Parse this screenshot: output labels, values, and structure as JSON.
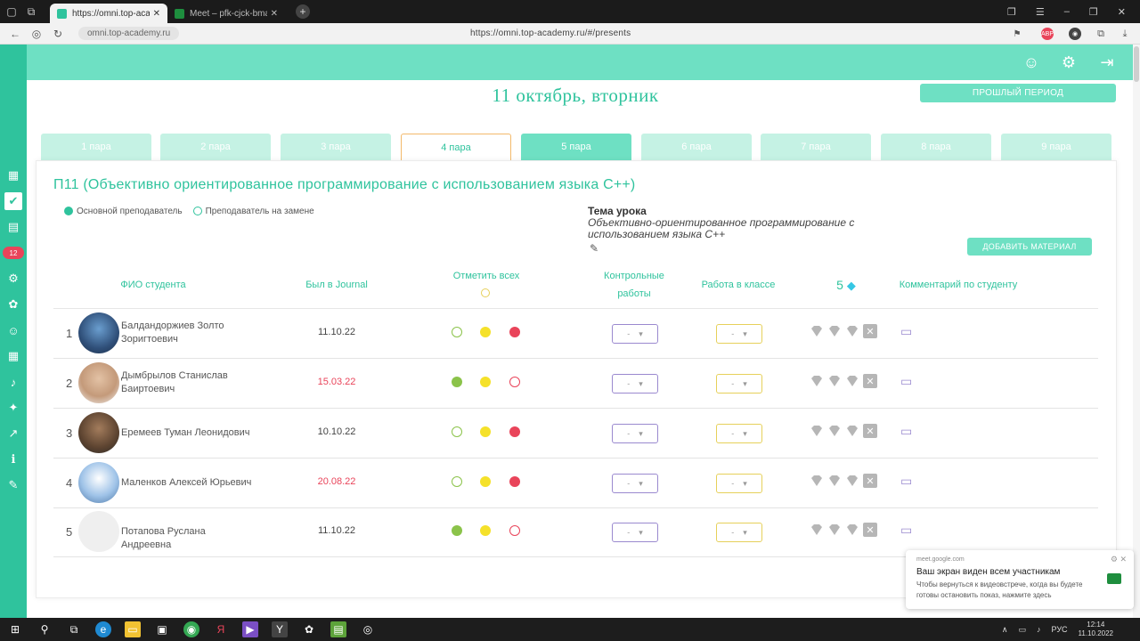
{
  "browser": {
    "tabs": [
      {
        "title": "https://omni.top-acade",
        "active": true
      },
      {
        "title": "Meet – pfk-cjck-bma",
        "active": false
      }
    ],
    "address_short": "omni.top-academy.ru",
    "url": "https://omni.top-academy.ru/#/presents"
  },
  "header": {
    "date": "11 октябрь, вторник",
    "prev_period_label": "ПРОШЛЫЙ ПЕРИОД"
  },
  "sidebar": {
    "badge": "12"
  },
  "pairs": [
    "1 пара",
    "2 пара",
    "3 пара",
    "4 пара",
    "5 пара",
    "6 пара",
    "7 пара",
    "8 пара",
    "9 пара"
  ],
  "group": {
    "title": "П11 (Объективно ориентированное программирование с использованием языка С++)",
    "legend_main": "Основной преподаватель",
    "legend_sub": "Преподаватель на замене",
    "topic_label": "Тема урока",
    "topic_text": "Объективно-ориентированное программирование с использованием языка С++",
    "add_material_label": "ДОБАВИТЬ МАТЕРИАЛ"
  },
  "table": {
    "col_name": "ФИО студента",
    "col_journal": "Был в Journal",
    "col_mark_all": "Отметить всех",
    "col_control": "Контрольные работы",
    "col_classwork": "Работа в классе",
    "col_gems": "5",
    "col_comment": "Комментарий по студенту",
    "select_placeholder": "-",
    "rows": [
      {
        "num": "1",
        "name": "Балдандоржиев Золто Зоригтоевич",
        "visit": "11.10.22",
        "late": false,
        "att": [
          "open-green",
          "yellow",
          "red"
        ]
      },
      {
        "num": "2",
        "name": "Дымбрылов Станислав Баиртоевич",
        "visit": "15.03.22",
        "late": true,
        "att": [
          "green",
          "yellow",
          "open-red"
        ]
      },
      {
        "num": "3",
        "name": "Еремеев Туман Леонидович",
        "visit": "10.10.22",
        "late": false,
        "att": [
          "open-green",
          "yellow",
          "red"
        ]
      },
      {
        "num": "4",
        "name": "Маленков Алексей Юрьевич",
        "visit": "20.08.22",
        "late": true,
        "att": [
          "open-green",
          "yellow",
          "red"
        ]
      },
      {
        "num": "5",
        "name": "Потапова Руслана Андреевна",
        "visit": "11.10.22",
        "late": false,
        "att": [
          "green",
          "yellow",
          "open-red"
        ]
      }
    ]
  },
  "colors": {
    "accent": "#2fc39d",
    "header": "#6ee0c3",
    "present": "#8bc34a",
    "late": "#f5e12a",
    "absent": "#e9445a"
  },
  "notification": {
    "source": "meet.google.com",
    "title": "Ваш экран виден всем участникам",
    "body": "Чтобы вернуться к видеовстрече, когда вы будете готовы остановить показ, нажмите здесь"
  },
  "taskbar": {
    "lang": "РУС",
    "time": "12:14",
    "date": "11.10.2022"
  }
}
